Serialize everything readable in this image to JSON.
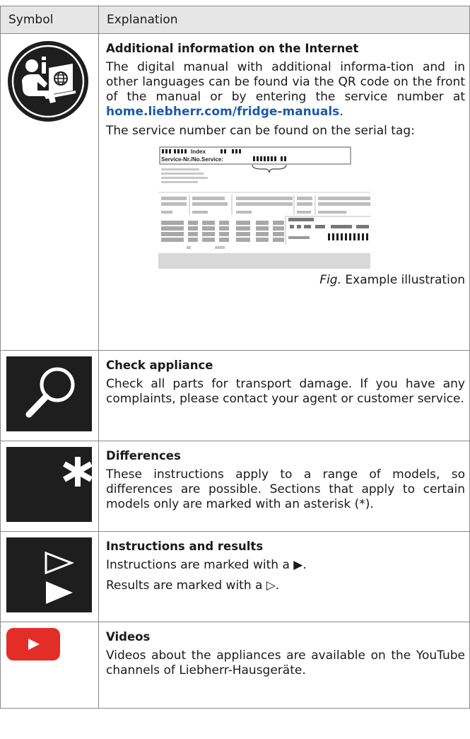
{
  "header": {
    "symbol": "Symbol",
    "explanation": "Explanation"
  },
  "rows": {
    "internet": {
      "icon": "info-internet-icon",
      "title": "Additional information on the Internet",
      "para1_pre": "The digital manual with additional informa-tion and in other languages can be found via the QR code on the front of the manual or by entering the service number at ",
      "link": "home.liebherr.com/fridge-manuals",
      "para1_post": ".",
      "para2": "The service number can be found on the serial tag:",
      "tag_index": "Index",
      "tag_service": "Service-Nr./No.Service:",
      "caption_fig": "Fig.",
      "caption_text": " Example illustration"
    },
    "check": {
      "icon": "magnifier-icon",
      "title": "Check appliance",
      "text": "Check all parts for transport damage. If you have any complaints, please contact your agent or customer service."
    },
    "differences": {
      "icon": "asterisk-icon",
      "title": "Differences",
      "text": "These instructions apply to a range of models, so differences are possible. Sections that apply to certain models only are marked with an asterisk (*)."
    },
    "instructions": {
      "icon": "triangle-arrows-icon",
      "title": "Instructions and results",
      "line1": "Instructions are marked with a ▶.",
      "line2": "Results are marked with a ▷."
    },
    "videos": {
      "icon": "youtube-icon",
      "title": "Videos",
      "text": "Videos about the appliances are available on the YouTube channels of Liebherr-Hausgeräte."
    }
  }
}
